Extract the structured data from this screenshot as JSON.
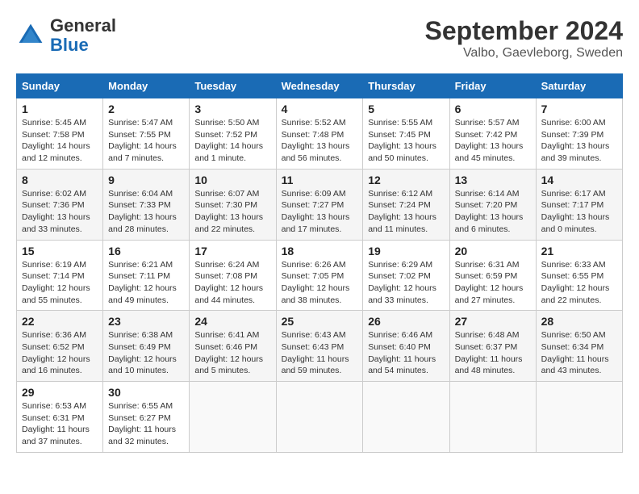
{
  "header": {
    "logo_general": "General",
    "logo_blue": "Blue",
    "month": "September 2024",
    "location": "Valbo, Gaevleborg, Sweden"
  },
  "columns": [
    "Sunday",
    "Monday",
    "Tuesday",
    "Wednesday",
    "Thursday",
    "Friday",
    "Saturday"
  ],
  "weeks": [
    [
      {
        "day": "1",
        "sunrise": "Sunrise: 5:45 AM",
        "sunset": "Sunset: 7:58 PM",
        "daylight": "Daylight: 14 hours and 12 minutes."
      },
      {
        "day": "2",
        "sunrise": "Sunrise: 5:47 AM",
        "sunset": "Sunset: 7:55 PM",
        "daylight": "Daylight: 14 hours and 7 minutes."
      },
      {
        "day": "3",
        "sunrise": "Sunrise: 5:50 AM",
        "sunset": "Sunset: 7:52 PM",
        "daylight": "Daylight: 14 hours and 1 minute."
      },
      {
        "day": "4",
        "sunrise": "Sunrise: 5:52 AM",
        "sunset": "Sunset: 7:48 PM",
        "daylight": "Daylight: 13 hours and 56 minutes."
      },
      {
        "day": "5",
        "sunrise": "Sunrise: 5:55 AM",
        "sunset": "Sunset: 7:45 PM",
        "daylight": "Daylight: 13 hours and 50 minutes."
      },
      {
        "day": "6",
        "sunrise": "Sunrise: 5:57 AM",
        "sunset": "Sunset: 7:42 PM",
        "daylight": "Daylight: 13 hours and 45 minutes."
      },
      {
        "day": "7",
        "sunrise": "Sunrise: 6:00 AM",
        "sunset": "Sunset: 7:39 PM",
        "daylight": "Daylight: 13 hours and 39 minutes."
      }
    ],
    [
      {
        "day": "8",
        "sunrise": "Sunrise: 6:02 AM",
        "sunset": "Sunset: 7:36 PM",
        "daylight": "Daylight: 13 hours and 33 minutes."
      },
      {
        "day": "9",
        "sunrise": "Sunrise: 6:04 AM",
        "sunset": "Sunset: 7:33 PM",
        "daylight": "Daylight: 13 hours and 28 minutes."
      },
      {
        "day": "10",
        "sunrise": "Sunrise: 6:07 AM",
        "sunset": "Sunset: 7:30 PM",
        "daylight": "Daylight: 13 hours and 22 minutes."
      },
      {
        "day": "11",
        "sunrise": "Sunrise: 6:09 AM",
        "sunset": "Sunset: 7:27 PM",
        "daylight": "Daylight: 13 hours and 17 minutes."
      },
      {
        "day": "12",
        "sunrise": "Sunrise: 6:12 AM",
        "sunset": "Sunset: 7:24 PM",
        "daylight": "Daylight: 13 hours and 11 minutes."
      },
      {
        "day": "13",
        "sunrise": "Sunrise: 6:14 AM",
        "sunset": "Sunset: 7:20 PM",
        "daylight": "Daylight: 13 hours and 6 minutes."
      },
      {
        "day": "14",
        "sunrise": "Sunrise: 6:17 AM",
        "sunset": "Sunset: 7:17 PM",
        "daylight": "Daylight: 13 hours and 0 minutes."
      }
    ],
    [
      {
        "day": "15",
        "sunrise": "Sunrise: 6:19 AM",
        "sunset": "Sunset: 7:14 PM",
        "daylight": "Daylight: 12 hours and 55 minutes."
      },
      {
        "day": "16",
        "sunrise": "Sunrise: 6:21 AM",
        "sunset": "Sunset: 7:11 PM",
        "daylight": "Daylight: 12 hours and 49 minutes."
      },
      {
        "day": "17",
        "sunrise": "Sunrise: 6:24 AM",
        "sunset": "Sunset: 7:08 PM",
        "daylight": "Daylight: 12 hours and 44 minutes."
      },
      {
        "day": "18",
        "sunrise": "Sunrise: 6:26 AM",
        "sunset": "Sunset: 7:05 PM",
        "daylight": "Daylight: 12 hours and 38 minutes."
      },
      {
        "day": "19",
        "sunrise": "Sunrise: 6:29 AM",
        "sunset": "Sunset: 7:02 PM",
        "daylight": "Daylight: 12 hours and 33 minutes."
      },
      {
        "day": "20",
        "sunrise": "Sunrise: 6:31 AM",
        "sunset": "Sunset: 6:59 PM",
        "daylight": "Daylight: 12 hours and 27 minutes."
      },
      {
        "day": "21",
        "sunrise": "Sunrise: 6:33 AM",
        "sunset": "Sunset: 6:55 PM",
        "daylight": "Daylight: 12 hours and 22 minutes."
      }
    ],
    [
      {
        "day": "22",
        "sunrise": "Sunrise: 6:36 AM",
        "sunset": "Sunset: 6:52 PM",
        "daylight": "Daylight: 12 hours and 16 minutes."
      },
      {
        "day": "23",
        "sunrise": "Sunrise: 6:38 AM",
        "sunset": "Sunset: 6:49 PM",
        "daylight": "Daylight: 12 hours and 10 minutes."
      },
      {
        "day": "24",
        "sunrise": "Sunrise: 6:41 AM",
        "sunset": "Sunset: 6:46 PM",
        "daylight": "Daylight: 12 hours and 5 minutes."
      },
      {
        "day": "25",
        "sunrise": "Sunrise: 6:43 AM",
        "sunset": "Sunset: 6:43 PM",
        "daylight": "Daylight: 11 hours and 59 minutes."
      },
      {
        "day": "26",
        "sunrise": "Sunrise: 6:46 AM",
        "sunset": "Sunset: 6:40 PM",
        "daylight": "Daylight: 11 hours and 54 minutes."
      },
      {
        "day": "27",
        "sunrise": "Sunrise: 6:48 AM",
        "sunset": "Sunset: 6:37 PM",
        "daylight": "Daylight: 11 hours and 48 minutes."
      },
      {
        "day": "28",
        "sunrise": "Sunrise: 6:50 AM",
        "sunset": "Sunset: 6:34 PM",
        "daylight": "Daylight: 11 hours and 43 minutes."
      }
    ],
    [
      {
        "day": "29",
        "sunrise": "Sunrise: 6:53 AM",
        "sunset": "Sunset: 6:31 PM",
        "daylight": "Daylight: 11 hours and 37 minutes."
      },
      {
        "day": "30",
        "sunrise": "Sunrise: 6:55 AM",
        "sunset": "Sunset: 6:27 PM",
        "daylight": "Daylight: 11 hours and 32 minutes."
      },
      null,
      null,
      null,
      null,
      null
    ]
  ]
}
